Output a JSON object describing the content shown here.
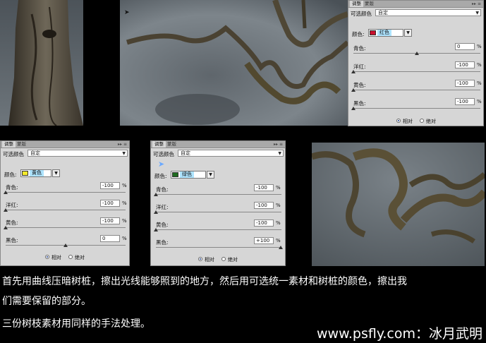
{
  "tabs": {
    "adjust": "调整",
    "mask": "蒙版"
  },
  "panel_top": {
    "preset_label": "可选颜色",
    "preset_value": "自定",
    "color_label": "颜色:",
    "color_name": "红色",
    "color_swatch": "#c8102e",
    "sliders": [
      {
        "label": "青色:",
        "value": "0",
        "unit": "%"
      },
      {
        "label": "洋红:",
        "value": "-100",
        "unit": "%"
      },
      {
        "label": "黄色:",
        "value": "-100",
        "unit": "%"
      },
      {
        "label": "黑色:",
        "value": "-100",
        "unit": "%"
      }
    ],
    "radio_relative": "相对",
    "radio_absolute": "绝对"
  },
  "panel_left": {
    "preset_label": "可选颜色",
    "preset_value": "自定",
    "color_label": "颜色:",
    "color_name": "黄色",
    "color_swatch": "#f5ea2a",
    "sliders": [
      {
        "label": "青色:",
        "value": "-100",
        "unit": "%"
      },
      {
        "label": "洋红:",
        "value": "-100",
        "unit": "%"
      },
      {
        "label": "黄色:",
        "value": "-100",
        "unit": "%"
      },
      {
        "label": "黑色:",
        "value": "0",
        "unit": "%"
      }
    ],
    "radio_relative": "相对",
    "radio_absolute": "绝对"
  },
  "panel_mid": {
    "preset_label": "可选颜色",
    "preset_value": "自定",
    "color_label": "颜色:",
    "color_name": "绿色",
    "color_swatch": "#1f6b1f",
    "sliders": [
      {
        "label": "青色:",
        "value": "-100",
        "unit": "%"
      },
      {
        "label": "洋红:",
        "value": "-100",
        "unit": "%"
      },
      {
        "label": "黄色:",
        "value": "-100",
        "unit": "%"
      },
      {
        "label": "黑色:",
        "value": "+100",
        "unit": "%"
      }
    ],
    "radio_relative": "相对",
    "radio_absolute": "绝对"
  },
  "caption": {
    "line1": "首先用曲线压暗树桩，擦出光线能够照到的地方，然后用可选统一素材和树桩的颜色，擦出我",
    "line2": "们需要保留的部分。",
    "line3": "三份树枝素材用同样的手法处理。"
  },
  "watermark": "www.psfly.com：冰月武明"
}
